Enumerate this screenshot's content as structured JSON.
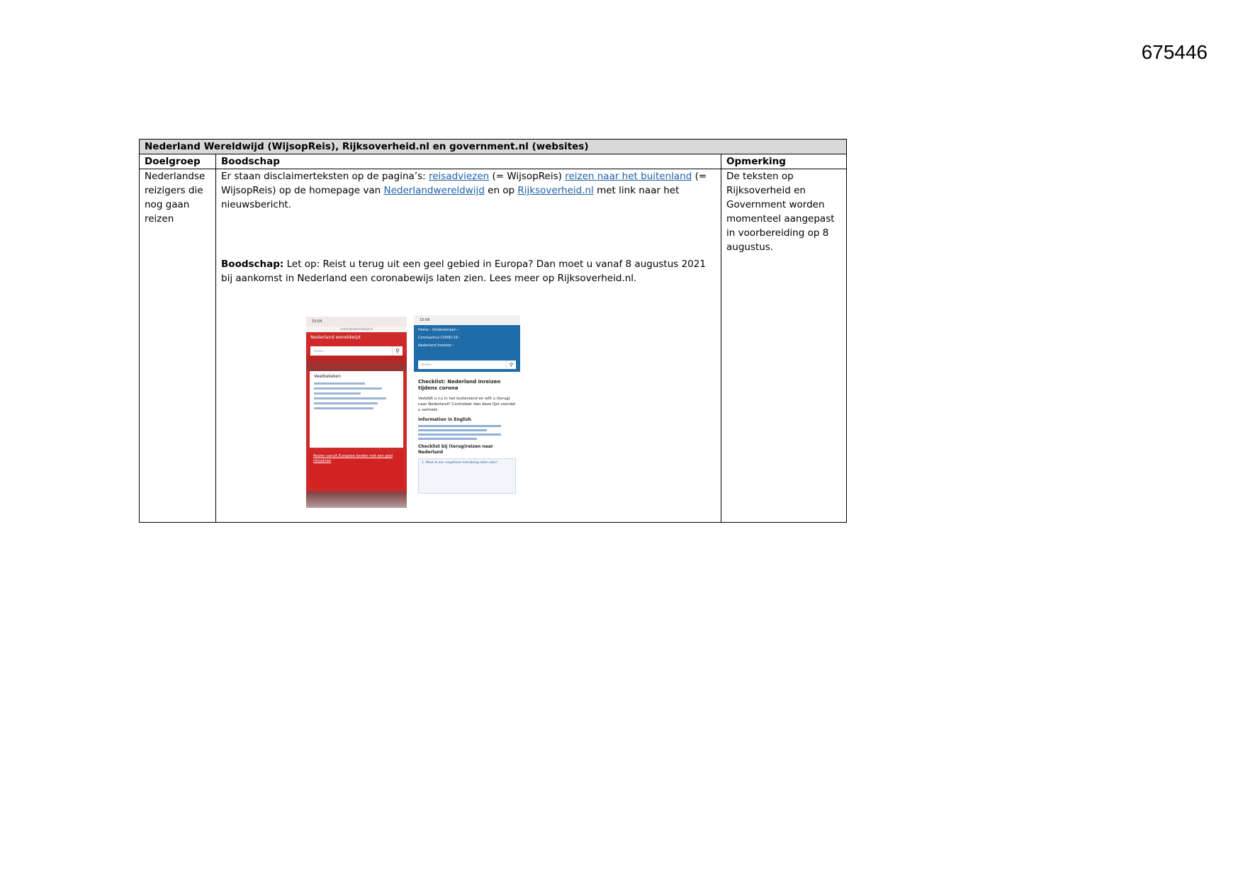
{
  "document": {
    "id_number": "675446"
  },
  "table": {
    "caption": "Nederland Wereldwijd (WijsopReis), Rijksoverheid.nl en government.nl (websites)",
    "headers": {
      "col1": "Doelgroep",
      "col2": "Boodschap",
      "col3": "Opmerking"
    },
    "row": {
      "doelgroep": "Nederlandse reizigers die nog gaan reizen",
      "boodschap_p1": {
        "t1": "Er staan disclaimerteksten op de pagina’s: ",
        "link1": "reisadviezen",
        "t2": " (= WijsopReis) ",
        "link2": "reizen naar het buitenland",
        "t3": " (= WijsopReis) op de homepage van ",
        "link3": "Nederlandwereldwijd",
        "t4": " en op ",
        "link4": "Rijksoverheid.nl",
        "t5": " met link naar het nieuwsbericht."
      },
      "boodschap_p2": {
        "label": "Boodschap:",
        "text": " Let op: Reist u terug uit een geel gebied in Europa? Dan moet u vanaf 8 augustus 2021 bij aankomst in Nederland een coronabewijs laten zien. Lees meer op Rijksoverheid.nl."
      },
      "opmerking": "De teksten op Rijksoverheid en Government worden momenteel aangepast in voorbereiding op 8 augustus."
    }
  },
  "screenshots": {
    "phone1": {
      "time": "15:04",
      "url": "nederlandwereldwijd.nl",
      "title": "Nederland wereldwijd",
      "search_placeholder": "Zoeken",
      "card_heading": "Veelbekeken",
      "bottom_title": "Reizen vanuit Europese landen met een geel reisadvies"
    },
    "phone2": {
      "time": "15:09",
      "crumb1": "Home  ›  Onderwerpen  ›",
      "crumb2": "Coronavirus COVID-19  ›",
      "crumb3": "Nederland inreizen  ›",
      "search_placeholder": "Zoeken",
      "heading": "Checklist: Nederland inreizen tijdens corona",
      "intro": "Verblijft u nu in het buitenland en wilt u (terug) naar Nederland? Controleer dan deze lijst voordat u vertrekt.",
      "sub1": "Information in English",
      "sub2": "Checklist bij (terug)reizen naar Nederland",
      "box": "1. Moet ik een negatieve testuitslag laten zien?"
    }
  }
}
